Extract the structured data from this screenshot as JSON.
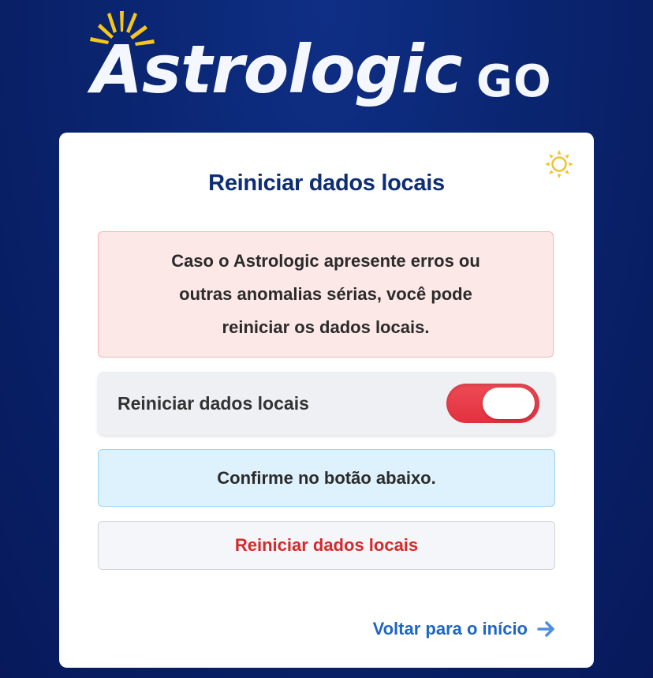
{
  "brand": {
    "name": "Astrologic",
    "suffix": "GO",
    "icon": "sun-rays-icon",
    "colors": {
      "ray": "#f6c718",
      "text": "#f5f7ff",
      "background": "#0a2570"
    }
  },
  "card": {
    "title": "Reiniciar dados locais",
    "theme_toggle_icon": "sun-icon",
    "warning": {
      "text": "Caso o Astrologic apresente erros ou outras anomalias sérias, você pode reiniciar os dados locais."
    },
    "toggle": {
      "label": "Reiniciar dados locais",
      "state": "on",
      "color": "#e1313f"
    },
    "info": {
      "text": "Confirme no botão abaixo."
    },
    "reset_button": {
      "label": "Reiniciar dados locais",
      "color": "#d52a2a"
    },
    "back_link": {
      "label": "Voltar para o início",
      "icon": "arrow-right-icon",
      "color": "#1f66c4"
    }
  }
}
